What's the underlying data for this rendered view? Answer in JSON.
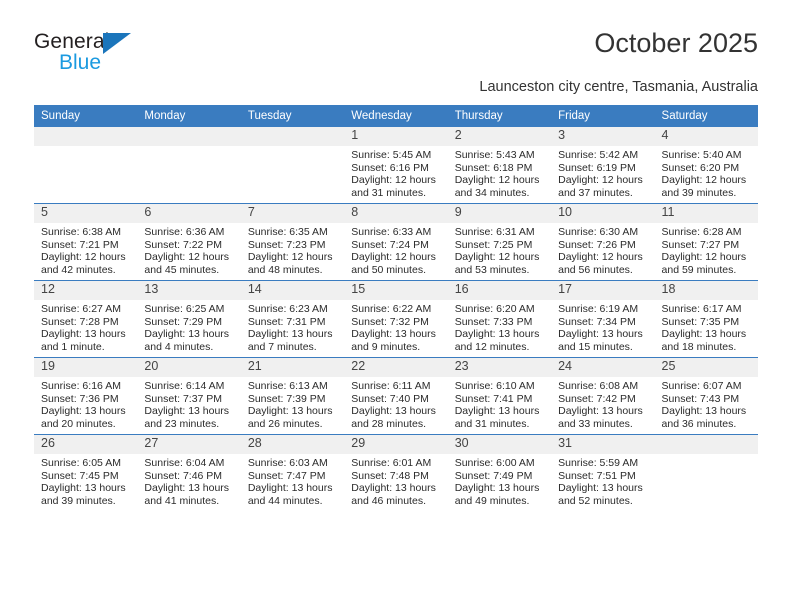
{
  "brand": {
    "name_top": "General",
    "name_bottom": "Blue"
  },
  "header": {
    "title": "October 2025",
    "subtitle": "Launceston city centre, Tasmania, Australia"
  },
  "colors": {
    "header_blue": "#3a7cc0",
    "logo_dark": "#231f20",
    "logo_blue": "#1b9ae0",
    "triangle_blue": "#1b75bb",
    "daynum_band": "#f0f0f0"
  },
  "weekdays": [
    "Sunday",
    "Monday",
    "Tuesday",
    "Wednesday",
    "Thursday",
    "Friday",
    "Saturday"
  ],
  "weeks": [
    [
      {
        "day": "",
        "empty": true
      },
      {
        "day": "",
        "empty": true
      },
      {
        "day": "",
        "empty": true
      },
      {
        "day": "1",
        "sunrise": "Sunrise: 5:45 AM",
        "sunset": "Sunset: 6:16 PM",
        "daylight_1": "Daylight: 12 hours",
        "daylight_2": "and 31 minutes."
      },
      {
        "day": "2",
        "sunrise": "Sunrise: 5:43 AM",
        "sunset": "Sunset: 6:18 PM",
        "daylight_1": "Daylight: 12 hours",
        "daylight_2": "and 34 minutes."
      },
      {
        "day": "3",
        "sunrise": "Sunrise: 5:42 AM",
        "sunset": "Sunset: 6:19 PM",
        "daylight_1": "Daylight: 12 hours",
        "daylight_2": "and 37 minutes."
      },
      {
        "day": "4",
        "sunrise": "Sunrise: 5:40 AM",
        "sunset": "Sunset: 6:20 PM",
        "daylight_1": "Daylight: 12 hours",
        "daylight_2": "and 39 minutes."
      }
    ],
    [
      {
        "day": "5",
        "sunrise": "Sunrise: 6:38 AM",
        "sunset": "Sunset: 7:21 PM",
        "daylight_1": "Daylight: 12 hours",
        "daylight_2": "and 42 minutes."
      },
      {
        "day": "6",
        "sunrise": "Sunrise: 6:36 AM",
        "sunset": "Sunset: 7:22 PM",
        "daylight_1": "Daylight: 12 hours",
        "daylight_2": "and 45 minutes."
      },
      {
        "day": "7",
        "sunrise": "Sunrise: 6:35 AM",
        "sunset": "Sunset: 7:23 PM",
        "daylight_1": "Daylight: 12 hours",
        "daylight_2": "and 48 minutes."
      },
      {
        "day": "8",
        "sunrise": "Sunrise: 6:33 AM",
        "sunset": "Sunset: 7:24 PM",
        "daylight_1": "Daylight: 12 hours",
        "daylight_2": "and 50 minutes."
      },
      {
        "day": "9",
        "sunrise": "Sunrise: 6:31 AM",
        "sunset": "Sunset: 7:25 PM",
        "daylight_1": "Daylight: 12 hours",
        "daylight_2": "and 53 minutes."
      },
      {
        "day": "10",
        "sunrise": "Sunrise: 6:30 AM",
        "sunset": "Sunset: 7:26 PM",
        "daylight_1": "Daylight: 12 hours",
        "daylight_2": "and 56 minutes."
      },
      {
        "day": "11",
        "sunrise": "Sunrise: 6:28 AM",
        "sunset": "Sunset: 7:27 PM",
        "daylight_1": "Daylight: 12 hours",
        "daylight_2": "and 59 minutes."
      }
    ],
    [
      {
        "day": "12",
        "sunrise": "Sunrise: 6:27 AM",
        "sunset": "Sunset: 7:28 PM",
        "daylight_1": "Daylight: 13 hours",
        "daylight_2": "and 1 minute."
      },
      {
        "day": "13",
        "sunrise": "Sunrise: 6:25 AM",
        "sunset": "Sunset: 7:29 PM",
        "daylight_1": "Daylight: 13 hours",
        "daylight_2": "and 4 minutes."
      },
      {
        "day": "14",
        "sunrise": "Sunrise: 6:23 AM",
        "sunset": "Sunset: 7:31 PM",
        "daylight_1": "Daylight: 13 hours",
        "daylight_2": "and 7 minutes."
      },
      {
        "day": "15",
        "sunrise": "Sunrise: 6:22 AM",
        "sunset": "Sunset: 7:32 PM",
        "daylight_1": "Daylight: 13 hours",
        "daylight_2": "and 9 minutes."
      },
      {
        "day": "16",
        "sunrise": "Sunrise: 6:20 AM",
        "sunset": "Sunset: 7:33 PM",
        "daylight_1": "Daylight: 13 hours",
        "daylight_2": "and 12 minutes."
      },
      {
        "day": "17",
        "sunrise": "Sunrise: 6:19 AM",
        "sunset": "Sunset: 7:34 PM",
        "daylight_1": "Daylight: 13 hours",
        "daylight_2": "and 15 minutes."
      },
      {
        "day": "18",
        "sunrise": "Sunrise: 6:17 AM",
        "sunset": "Sunset: 7:35 PM",
        "daylight_1": "Daylight: 13 hours",
        "daylight_2": "and 18 minutes."
      }
    ],
    [
      {
        "day": "19",
        "sunrise": "Sunrise: 6:16 AM",
        "sunset": "Sunset: 7:36 PM",
        "daylight_1": "Daylight: 13 hours",
        "daylight_2": "and 20 minutes."
      },
      {
        "day": "20",
        "sunrise": "Sunrise: 6:14 AM",
        "sunset": "Sunset: 7:37 PM",
        "daylight_1": "Daylight: 13 hours",
        "daylight_2": "and 23 minutes."
      },
      {
        "day": "21",
        "sunrise": "Sunrise: 6:13 AM",
        "sunset": "Sunset: 7:39 PM",
        "daylight_1": "Daylight: 13 hours",
        "daylight_2": "and 26 minutes."
      },
      {
        "day": "22",
        "sunrise": "Sunrise: 6:11 AM",
        "sunset": "Sunset: 7:40 PM",
        "daylight_1": "Daylight: 13 hours",
        "daylight_2": "and 28 minutes."
      },
      {
        "day": "23",
        "sunrise": "Sunrise: 6:10 AM",
        "sunset": "Sunset: 7:41 PM",
        "daylight_1": "Daylight: 13 hours",
        "daylight_2": "and 31 minutes."
      },
      {
        "day": "24",
        "sunrise": "Sunrise: 6:08 AM",
        "sunset": "Sunset: 7:42 PM",
        "daylight_1": "Daylight: 13 hours",
        "daylight_2": "and 33 minutes."
      },
      {
        "day": "25",
        "sunrise": "Sunrise: 6:07 AM",
        "sunset": "Sunset: 7:43 PM",
        "daylight_1": "Daylight: 13 hours",
        "daylight_2": "and 36 minutes."
      }
    ],
    [
      {
        "day": "26",
        "sunrise": "Sunrise: 6:05 AM",
        "sunset": "Sunset: 7:45 PM",
        "daylight_1": "Daylight: 13 hours",
        "daylight_2": "and 39 minutes."
      },
      {
        "day": "27",
        "sunrise": "Sunrise: 6:04 AM",
        "sunset": "Sunset: 7:46 PM",
        "daylight_1": "Daylight: 13 hours",
        "daylight_2": "and 41 minutes."
      },
      {
        "day": "28",
        "sunrise": "Sunrise: 6:03 AM",
        "sunset": "Sunset: 7:47 PM",
        "daylight_1": "Daylight: 13 hours",
        "daylight_2": "and 44 minutes."
      },
      {
        "day": "29",
        "sunrise": "Sunrise: 6:01 AM",
        "sunset": "Sunset: 7:48 PM",
        "daylight_1": "Daylight: 13 hours",
        "daylight_2": "and 46 minutes."
      },
      {
        "day": "30",
        "sunrise": "Sunrise: 6:00 AM",
        "sunset": "Sunset: 7:49 PM",
        "daylight_1": "Daylight: 13 hours",
        "daylight_2": "and 49 minutes."
      },
      {
        "day": "31",
        "sunrise": "Sunrise: 5:59 AM",
        "sunset": "Sunset: 7:51 PM",
        "daylight_1": "Daylight: 13 hours",
        "daylight_2": "and 52 minutes."
      },
      {
        "day": "",
        "empty": true
      }
    ]
  ]
}
